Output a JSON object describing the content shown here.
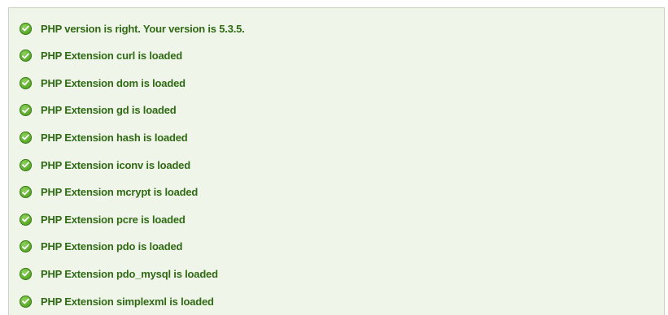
{
  "checks": [
    {
      "status": "ok",
      "icon": "check-circle-icon",
      "text": "PHP version is right. Your version is 5.3.5."
    },
    {
      "status": "ok",
      "icon": "check-circle-icon",
      "text": "PHP Extension curl is loaded"
    },
    {
      "status": "ok",
      "icon": "check-circle-icon",
      "text": "PHP Extension dom is loaded"
    },
    {
      "status": "ok",
      "icon": "check-circle-icon",
      "text": "PHP Extension gd is loaded"
    },
    {
      "status": "ok",
      "icon": "check-circle-icon",
      "text": "PHP Extension hash is loaded"
    },
    {
      "status": "ok",
      "icon": "check-circle-icon",
      "text": "PHP Extension iconv is loaded"
    },
    {
      "status": "ok",
      "icon": "check-circle-icon",
      "text": "PHP Extension mcrypt is loaded"
    },
    {
      "status": "ok",
      "icon": "check-circle-icon",
      "text": "PHP Extension pcre is loaded"
    },
    {
      "status": "ok",
      "icon": "check-circle-icon",
      "text": "PHP Extension pdo is loaded"
    },
    {
      "status": "ok",
      "icon": "check-circle-icon",
      "text": "PHP Extension pdo_mysql is loaded"
    },
    {
      "status": "ok",
      "icon": "check-circle-icon",
      "text": "PHP Extension simplexml is loaded"
    }
  ],
  "colors": {
    "text": "#2e6b12",
    "icon": "#5fae2c",
    "panel_background": "#f0f5ea",
    "panel_border": "#c9d3bd"
  }
}
